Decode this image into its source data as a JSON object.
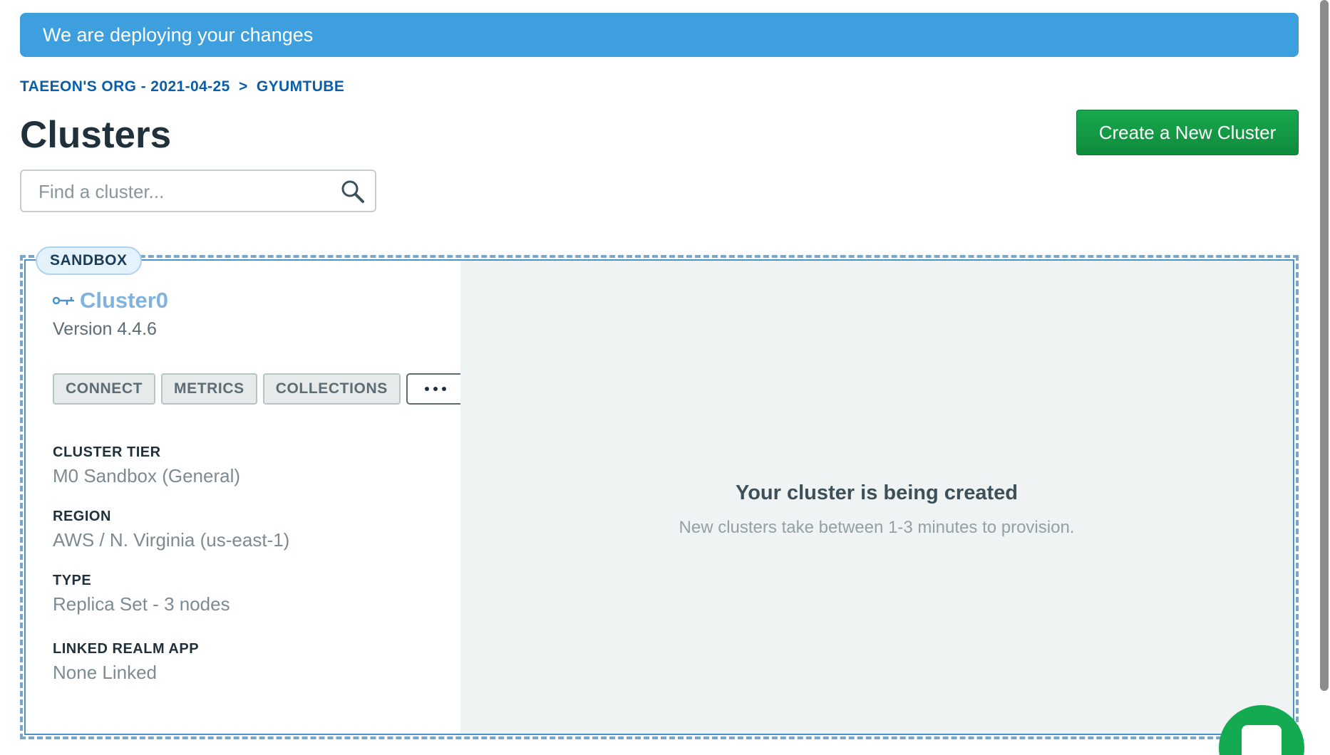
{
  "banner": {
    "message": "We are deploying your changes",
    "color": "#3d9fdd"
  },
  "breadcrumb": {
    "org": "TAEEON'S ORG - 2021-04-25",
    "separator": ">",
    "project": "GYUMTUBE"
  },
  "page": {
    "title": "Clusters",
    "create_button_label": "Create a New Cluster",
    "create_button_color": "#13aa52"
  },
  "search": {
    "placeholder": "Find a cluster...",
    "value": "",
    "icon": "search-icon"
  },
  "cluster": {
    "badge": "SANDBOX",
    "name": "Cluster0",
    "name_icon": "connector-icon",
    "version": "Version 4.4.6",
    "buttons": {
      "connect": "CONNECT",
      "metrics": "METRICS",
      "collections": "COLLECTIONS",
      "more_icon": "ellipsis-icon"
    },
    "info": [
      {
        "label": "CLUSTER TIER",
        "value": "M0 Sandbox (General)"
      },
      {
        "label": "REGION",
        "value": "AWS / N. Virginia (us-east-1)"
      },
      {
        "label": "TYPE",
        "value": "Replica Set - 3 nodes"
      },
      {
        "label": "LINKED REALM APP",
        "value": "None Linked"
      }
    ],
    "status": {
      "title": "Your cluster is being created",
      "subtitle": "New clusters take between 1-3 minutes to provision."
    }
  },
  "chat": {
    "icon": "chat-icon"
  }
}
